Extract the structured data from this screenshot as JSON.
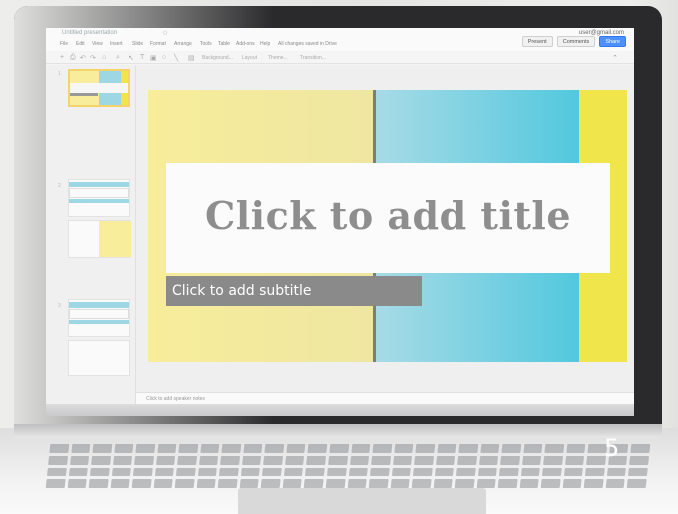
{
  "app": {
    "doc_title": "Untitled presentation",
    "user": "user@gmail.com",
    "actions": {
      "present": "Present",
      "comments": "Comments",
      "share": "Share"
    },
    "menu": [
      "File",
      "Edit",
      "View",
      "Insert",
      "Slide",
      "Format",
      "Arrange",
      "Tools",
      "Table",
      "Add-ons",
      "Help",
      "All changes saved in Drive"
    ],
    "toolbar": {
      "background_label": "Background...",
      "layout_label": "Layout",
      "theme_label": "Theme...",
      "transition_label": "Transition..."
    }
  },
  "filmstrip": {
    "slides": [
      "1",
      "2",
      "3"
    ]
  },
  "slide": {
    "title_placeholder": "Click to add title",
    "subtitle_placeholder": "Click to add subtitle"
  },
  "notes": {
    "placeholder": "Click to add speaker notes"
  },
  "overlay": {
    "slide_number": "5"
  },
  "colors": {
    "yellow": "#f1e54c",
    "blue": "#52c8de",
    "divider": "#7d7d7d",
    "share_button": "#4d90fe"
  }
}
